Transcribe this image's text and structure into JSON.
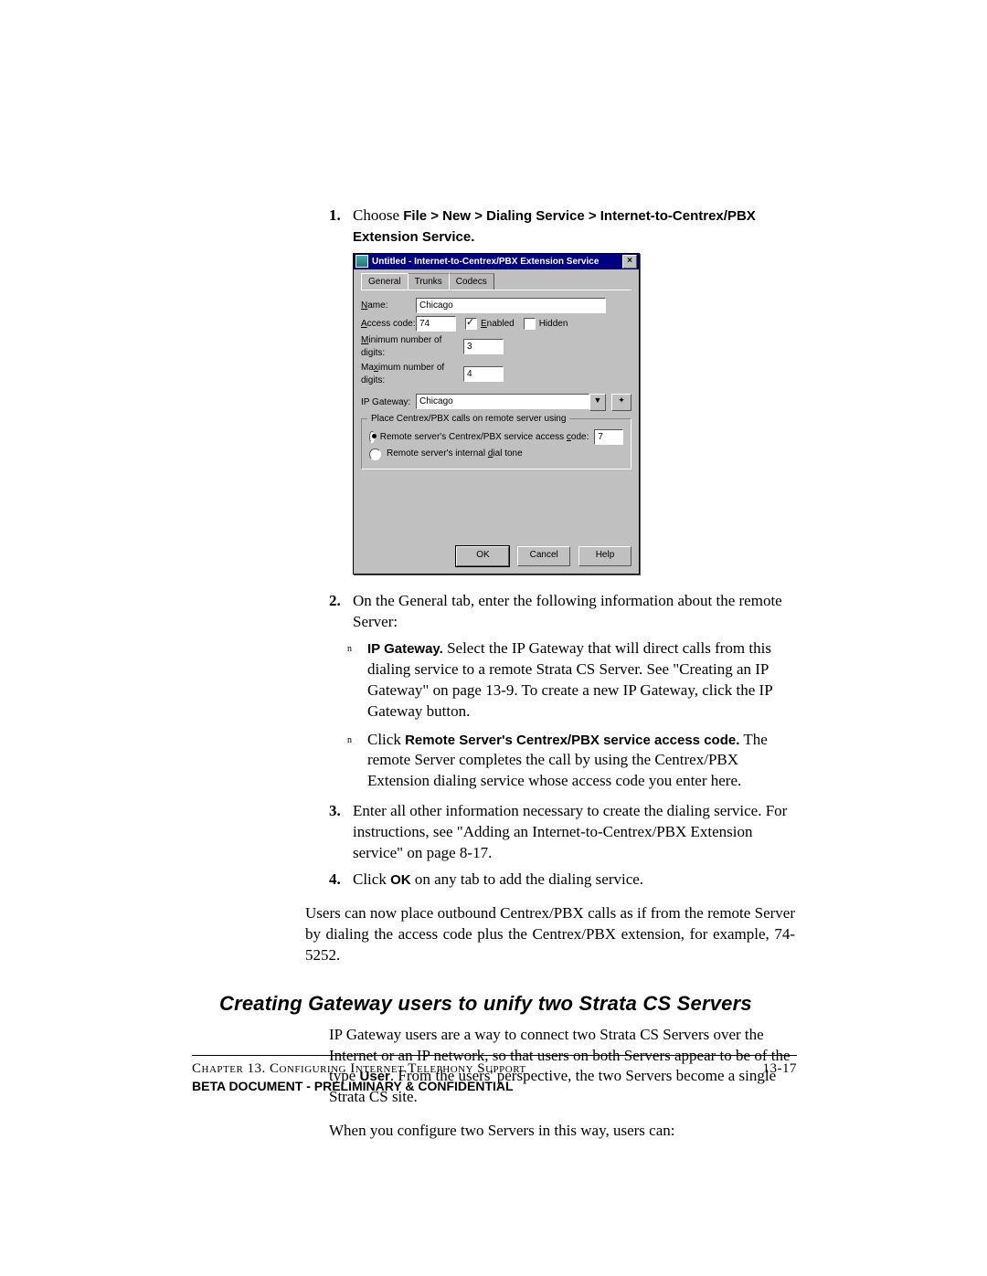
{
  "steps": {
    "s1": {
      "num": "1.",
      "pre": "Choose ",
      "bold": "File > New > Dialing Service > Internet-to-Centrex/PBX Extension Service."
    },
    "s2": {
      "num": "2.",
      "text": "On the General tab, enter the following information about the remote Server:"
    },
    "s2a": {
      "mark": "n",
      "bold": "IP Gateway.",
      "rest": " Select the IP Gateway that will direct calls from this dialing service to a remote Strata CS Server. See \"Creating an IP Gateway\" on page 13-9. To create a new IP Gateway, click the IP Gateway button."
    },
    "s2b": {
      "mark": "n",
      "pre": "Click ",
      "bold": "Remote Server's Centrex/PBX service access code.",
      "rest": " The remote Server completes the call by using the Centrex/PBX Extension dialing service whose access code you enter here."
    },
    "s3": {
      "num": "3.",
      "text": "Enter all other information necessary to create the dialing service. For instructions, see \"Adding an Internet-to-Centrex/PBX Extension service\" on page 8-17."
    },
    "s4": {
      "num": "4.",
      "pre": "Click ",
      "bold": "OK",
      "rest": " on any tab to add the dialing service."
    }
  },
  "para1": "Users can now place outbound Centrex/PBX calls as if from the remote Server by dialing the access code plus the Centrex/PBX extension, for example, 74-5252.",
  "section_title": "Creating Gateway users to unify two Strata CS Servers",
  "para2_pre": "IP Gateway users are a way to connect two Strata CS Servers over the Internet or an IP network, so that users on both Servers appear to be of the type ",
  "para2_bold": "User",
  "para2_rest": ". From the users' perspective, the two Servers become a single Strata CS site.",
  "para3": "When you configure two Servers in this way, users can:",
  "footer": {
    "chapter": "Chapter 13. Configuring Internet Telephony Support",
    "page": "13-17",
    "confidential": "BETA DOCUMENT - PRELIMINARY & CONFIDENTIAL"
  },
  "dialog": {
    "title": "Untitled - Internet-to-Centrex/PBX Extension Service",
    "close": "×",
    "tabs": {
      "t1": "General",
      "t2": "Trunks",
      "t3": "Codecs"
    },
    "name_label": "Name:",
    "name_value": "Chicago",
    "access_label": "Access code:",
    "access_value": "74",
    "enabled": "Enabled",
    "hidden": "Hidden",
    "min_label": "Minimum number of digits:",
    "min_value": "3",
    "max_label": "Maximum number of digits:",
    "max_value": "4",
    "gw_label": "IP Gateway:",
    "gw_value": "Chicago",
    "dd_icon": "▼",
    "gw_icon": "✦",
    "group_title": "Place Centrex/PBX calls on remote server using",
    "radio1": "Remote server's Centrex/PBX service access code:",
    "radio1_value": "7",
    "radio2": "Remote server's internal dial tone",
    "ok": "OK",
    "cancel": "Cancel",
    "help": "Help"
  }
}
